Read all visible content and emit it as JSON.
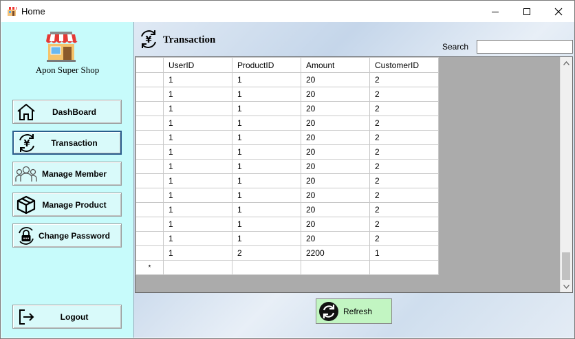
{
  "window": {
    "title": "Home"
  },
  "sidebar": {
    "shop_name": "Apon Super Shop",
    "items": [
      {
        "label": "DashBoard",
        "icon": "home-icon"
      },
      {
        "label": "Transaction",
        "icon": "yen-exchange-icon",
        "active": true
      },
      {
        "label": "Manage Member",
        "icon": "users-icon"
      },
      {
        "label": "Manage Product",
        "icon": "box-icon"
      },
      {
        "label": "Change Password",
        "icon": "lock-icon"
      }
    ],
    "logout_label": "Logout"
  },
  "main": {
    "title": "Transaction",
    "search_label": "Search",
    "search_value": "",
    "refresh_label": "Refresh"
  },
  "table": {
    "columns": [
      "UserID",
      "ProductID",
      "Amount",
      "CustomerID"
    ],
    "rows": [
      [
        "1",
        "1",
        "20",
        "2"
      ],
      [
        "1",
        "1",
        "20",
        "2"
      ],
      [
        "1",
        "1",
        "20",
        "2"
      ],
      [
        "1",
        "1",
        "20",
        "2"
      ],
      [
        "1",
        "1",
        "20",
        "2"
      ],
      [
        "1",
        "1",
        "20",
        "2"
      ],
      [
        "1",
        "1",
        "20",
        "2"
      ],
      [
        "1",
        "1",
        "20",
        "2"
      ],
      [
        "1",
        "1",
        "20",
        "2"
      ],
      [
        "1",
        "1",
        "20",
        "2"
      ],
      [
        "1",
        "1",
        "20",
        "2"
      ],
      [
        "1",
        "1",
        "20",
        "2"
      ],
      [
        "1",
        "2",
        "2200",
        "1"
      ]
    ],
    "new_row_marker": "*"
  },
  "colors": {
    "sidebar_bg": "#c7fbfb",
    "active_border": "#2a5d8c",
    "refresh_bg": "#c2f5c2",
    "grid_bg": "#ababab"
  }
}
